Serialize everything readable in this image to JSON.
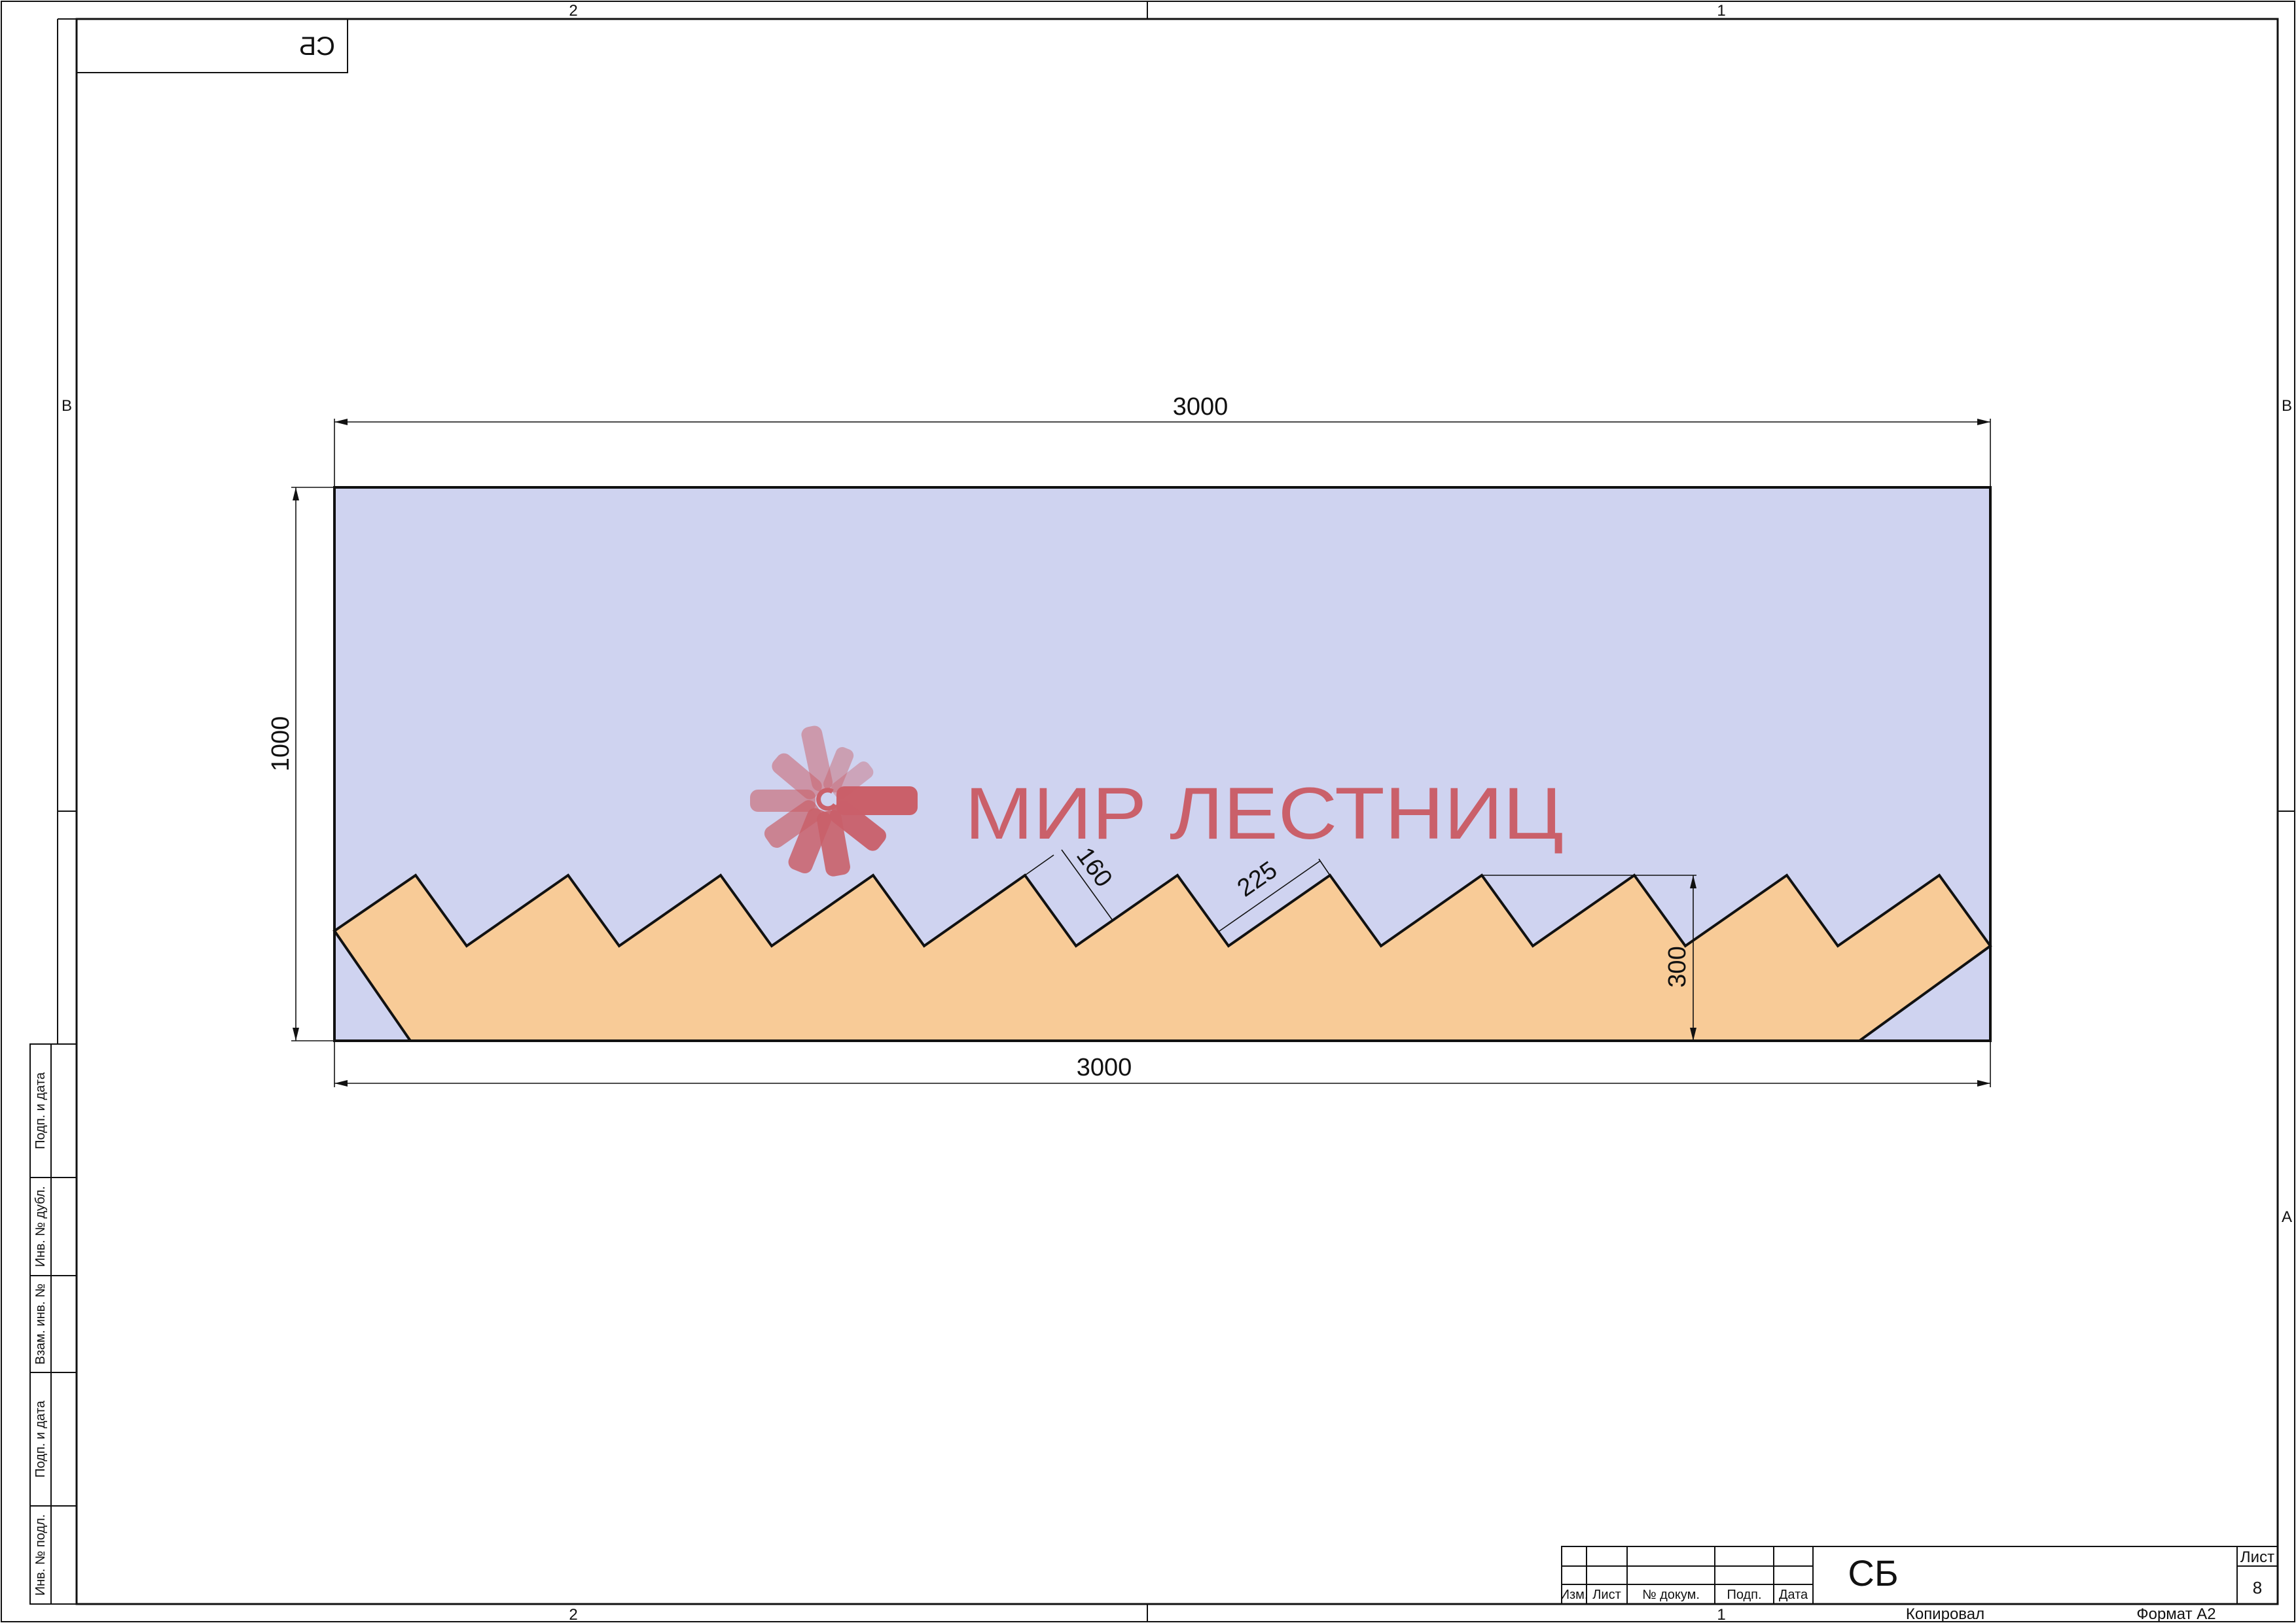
{
  "document": {
    "format_label": "Формат A2",
    "copied_label": "Копировал",
    "zones": {
      "top_left": "2",
      "top_right": "1",
      "bottom_left": "2",
      "bottom_right": "1",
      "left_upper": "В",
      "right_upper": "В",
      "right_lower": "А"
    },
    "stamp_mirrored": "СБ",
    "side_table": [
      "Подп. и дата",
      "Инв. № дубл.",
      "Взам. инв. №",
      "Подп. и дата",
      "Инв. № подл."
    ]
  },
  "title_block": {
    "headers": [
      "Изм.",
      "Лист",
      "№ докум.",
      "Подп.",
      "Дата"
    ],
    "designation": "СБ",
    "sheet_label": "Лист",
    "sheet_number": "8"
  },
  "drawing": {
    "dimensions": {
      "top_width": "3000",
      "bottom_width": "3000",
      "height": "1000",
      "tooth_height": "300",
      "tread": "225",
      "riser": "160"
    },
    "colors": {
      "panel_fill": "#cfd3f0",
      "stringer_fill": "#f8cb97",
      "outline": "#111111"
    }
  },
  "watermark": {
    "text": "МИР ЛЕСТНИЦ",
    "color": "#c8474c"
  }
}
